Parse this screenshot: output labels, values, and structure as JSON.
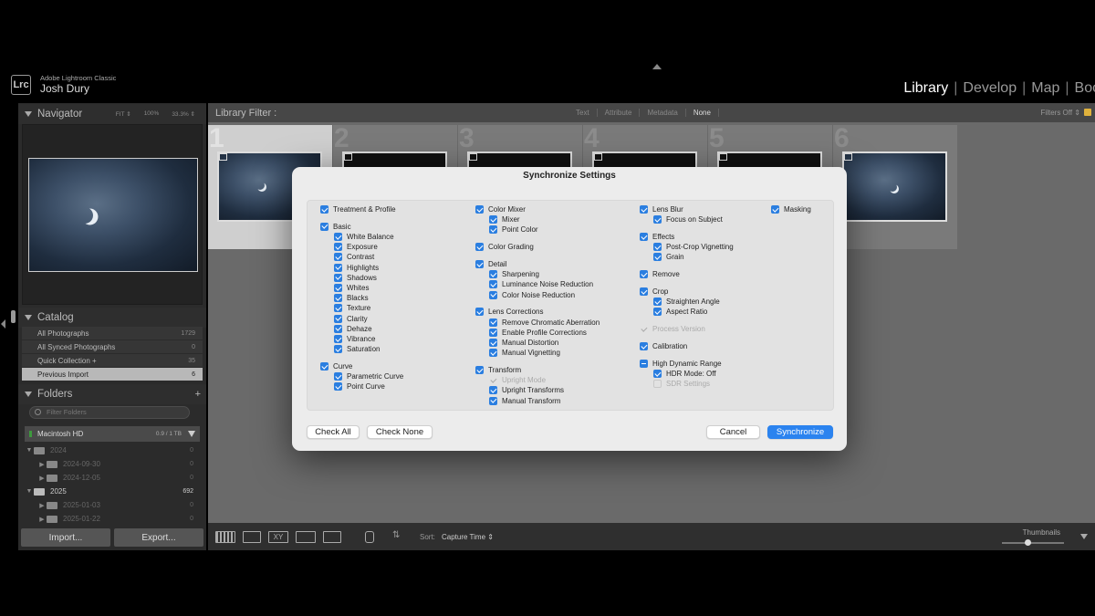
{
  "app": {
    "logo": "Lrc",
    "name": "Adobe Lightroom Classic",
    "user": "Josh Dury"
  },
  "modules": [
    "Library",
    "Develop",
    "Map",
    "Boo"
  ],
  "navigator": {
    "title": "Navigator",
    "zoom_options": [
      "FIT ⇕",
      "100%",
      "33.3% ⇕"
    ]
  },
  "catalog": {
    "title": "Catalog",
    "items": [
      {
        "label": "All Photographs",
        "count": "1729"
      },
      {
        "label": "All Synced Photographs",
        "count": "0"
      },
      {
        "label": "Quick Collection  +",
        "count": "35"
      },
      {
        "label": "Previous Import",
        "count": "6"
      }
    ]
  },
  "folders": {
    "title": "Folders",
    "add": "+",
    "filter_placeholder": "Filter Folders",
    "volume": {
      "name": "Macintosh HD",
      "size": "0.9 / 1 TB"
    },
    "rows": [
      {
        "label": "2024",
        "count": "0"
      },
      {
        "label": "2024-09-30",
        "count": "0"
      },
      {
        "label": "2024-12-05",
        "count": "0"
      },
      {
        "label": "2025",
        "count": "692"
      },
      {
        "label": "2025-01-03",
        "count": "0"
      },
      {
        "label": "2025-01-22",
        "count": "0"
      }
    ]
  },
  "buttons": {
    "import": "Import...",
    "export": "Export..."
  },
  "library_filter": {
    "title": "Library Filter :",
    "options": [
      "Text",
      "Attribute",
      "Metadata",
      "None"
    ],
    "status": "Filters Off ⇕"
  },
  "grid": {
    "indices": [
      "1",
      "2",
      "3",
      "4",
      "5",
      "6"
    ]
  },
  "toolbar": {
    "sort_label": "Sort:",
    "sort_value": "Capture Time ⇕",
    "thumbnails_label": "Thumbnails"
  },
  "dialog": {
    "title": "Synchronize Settings",
    "col1": [
      {
        "label": "Treatment & Profile",
        "state": "checked",
        "indent": 0,
        "gap": 0
      },
      {
        "label": "Basic",
        "state": "checked",
        "indent": 0,
        "gap": 1
      },
      {
        "label": "White Balance",
        "state": "checked",
        "indent": 1,
        "gap": 0
      },
      {
        "label": "Exposure",
        "state": "checked",
        "indent": 1,
        "gap": 0
      },
      {
        "label": "Contrast",
        "state": "checked",
        "indent": 1,
        "gap": 0
      },
      {
        "label": "Highlights",
        "state": "checked",
        "indent": 1,
        "gap": 0
      },
      {
        "label": "Shadows",
        "state": "checked",
        "indent": 1,
        "gap": 0
      },
      {
        "label": "Whites",
        "state": "checked",
        "indent": 1,
        "gap": 0
      },
      {
        "label": "Blacks",
        "state": "checked",
        "indent": 1,
        "gap": 0
      },
      {
        "label": "Texture",
        "state": "checked",
        "indent": 1,
        "gap": 0
      },
      {
        "label": "Clarity",
        "state": "checked",
        "indent": 1,
        "gap": 0
      },
      {
        "label": "Dehaze",
        "state": "checked",
        "indent": 1,
        "gap": 0
      },
      {
        "label": "Vibrance",
        "state": "checked",
        "indent": 1,
        "gap": 0
      },
      {
        "label": "Saturation",
        "state": "checked",
        "indent": 1,
        "gap": 0
      },
      {
        "label": "Curve",
        "state": "checked",
        "indent": 0,
        "gap": 1
      },
      {
        "label": "Parametric Curve",
        "state": "checked",
        "indent": 1,
        "gap": 0
      },
      {
        "label": "Point Curve",
        "state": "checked",
        "indent": 1,
        "gap": 0
      }
    ],
    "col2": [
      {
        "label": "Color Mixer",
        "state": "checked",
        "indent": 0,
        "gap": 0
      },
      {
        "label": "Mixer",
        "state": "checked",
        "indent": 1,
        "gap": 0
      },
      {
        "label": "Point Color",
        "state": "checked",
        "indent": 1,
        "gap": 0
      },
      {
        "label": "Color Grading",
        "state": "checked",
        "indent": 0,
        "gap": 1
      },
      {
        "label": "Detail",
        "state": "checked",
        "indent": 0,
        "gap": 1
      },
      {
        "label": "Sharpening",
        "state": "checked",
        "indent": 1,
        "gap": 0
      },
      {
        "label": "Luminance Noise Reduction",
        "state": "checked",
        "indent": 1,
        "gap": 0
      },
      {
        "label": "Color Noise Reduction",
        "state": "checked",
        "indent": 1,
        "gap": 0
      },
      {
        "label": "Lens Corrections",
        "state": "checked",
        "indent": 0,
        "gap": 1
      },
      {
        "label": "Remove Chromatic Aberration",
        "state": "checked",
        "indent": 1,
        "gap": 0
      },
      {
        "label": "Enable Profile Corrections",
        "state": "checked",
        "indent": 1,
        "gap": 0
      },
      {
        "label": "Manual Distortion",
        "state": "checked",
        "indent": 1,
        "gap": 0
      },
      {
        "label": "Manual Vignetting",
        "state": "checked",
        "indent": 1,
        "gap": 0
      },
      {
        "label": "Transform",
        "state": "checked",
        "indent": 0,
        "gap": 1
      },
      {
        "label": "Upright Mode",
        "state": "disabled-checked",
        "indent": 1,
        "gap": 0
      },
      {
        "label": "Upright Transforms",
        "state": "checked",
        "indent": 1,
        "gap": 0
      },
      {
        "label": "Manual Transform",
        "state": "checked",
        "indent": 1,
        "gap": 0
      }
    ],
    "col3": [
      {
        "label": "Lens Blur",
        "state": "checked",
        "indent": 0,
        "gap": 0
      },
      {
        "label": "Focus on Subject",
        "state": "checked",
        "indent": 1,
        "gap": 0
      },
      {
        "label": "Effects",
        "state": "checked",
        "indent": 0,
        "gap": 1
      },
      {
        "label": "Post-Crop Vignetting",
        "state": "checked",
        "indent": 1,
        "gap": 0
      },
      {
        "label": "Grain",
        "state": "checked",
        "indent": 1,
        "gap": 0
      },
      {
        "label": "Remove",
        "state": "checked",
        "indent": 0,
        "gap": 1
      },
      {
        "label": "Crop",
        "state": "checked",
        "indent": 0,
        "gap": 1
      },
      {
        "label": "Straighten Angle",
        "state": "checked",
        "indent": 1,
        "gap": 0
      },
      {
        "label": "Aspect Ratio",
        "state": "checked",
        "indent": 1,
        "gap": 0
      },
      {
        "label": "Process Version",
        "state": "disabled-checked",
        "indent": 0,
        "gap": 1
      },
      {
        "label": "Calibration",
        "state": "checked",
        "indent": 0,
        "gap": 1
      },
      {
        "label": "High Dynamic Range",
        "state": "mixed",
        "indent": 0,
        "gap": 1
      },
      {
        "label": "HDR Mode: Off",
        "state": "checked",
        "indent": 1,
        "gap": 0
      },
      {
        "label": "SDR Settings",
        "state": "disabled",
        "indent": 1,
        "gap": 0
      }
    ],
    "col4": [
      {
        "label": "Masking",
        "state": "checked",
        "indent": 0,
        "gap": 0
      }
    ],
    "buttons": {
      "check_all": "Check All",
      "check_none": "Check None",
      "cancel": "Cancel",
      "synchronize": "Synchronize"
    }
  },
  "colors": {
    "accent": "#2b83ef",
    "panel_bg": "#2b2b2b",
    "grid_bg": "#6a6a6a",
    "dialog_bg": "#ececec"
  }
}
